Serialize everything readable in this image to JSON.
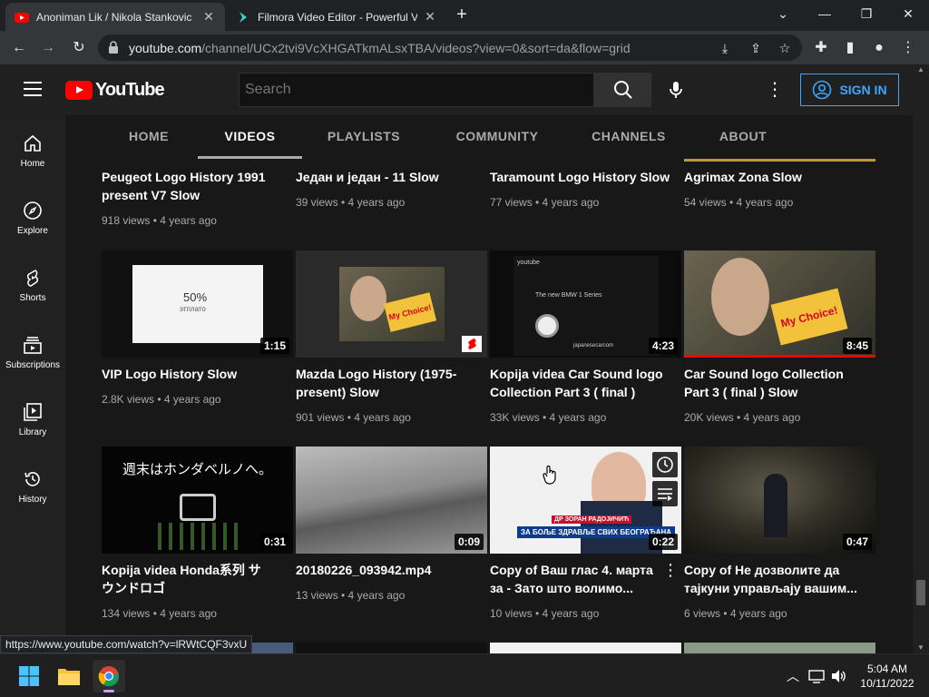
{
  "browser": {
    "tabs": [
      {
        "title": "Anoniman Lik / Nikola Stankovic",
        "active": true
      },
      {
        "title": "Filmora Video Editor - Powerful V",
        "active": false
      }
    ],
    "url_host": "youtube.com",
    "url_path": "/channel/UCx2tvi9VcXHGATkmALsxTBA/videos?view=0&sort=da&flow=grid",
    "status_url": "https://www.youtube.com/watch?v=lRWtCQF3vxU"
  },
  "youtube": {
    "logo_text": "YouTube",
    "search_placeholder": "Search",
    "sign_in": "SIGN IN",
    "guide": [
      {
        "label": "Home",
        "icon": "home-icon"
      },
      {
        "label": "Explore",
        "icon": "compass-icon"
      },
      {
        "label": "Shorts",
        "icon": "shorts-icon"
      },
      {
        "label": "Subscriptions",
        "icon": "subscriptions-icon"
      },
      {
        "label": "Library",
        "icon": "library-icon"
      },
      {
        "label": "History",
        "icon": "history-icon"
      }
    ],
    "channel_tabs": [
      {
        "label": "HOME"
      },
      {
        "label": "VIDEOS"
      },
      {
        "label": "PLAYLISTS"
      },
      {
        "label": "COMMUNITY"
      },
      {
        "label": "CHANNELS"
      },
      {
        "label": "ABOUT"
      }
    ],
    "active_tab": "VIDEOS",
    "row0": [
      {
        "title1": "Peugeot Logo History 1991",
        "title2": "present V7 Slow",
        "meta": "918 views • 4 years ago"
      },
      {
        "title1": "Један и један - 11 Slow",
        "title2": "",
        "meta": "39 views • 4 years ago"
      },
      {
        "title1": "Taramount Logo History Slow",
        "title2": "",
        "meta": "77 views • 4 years ago"
      },
      {
        "title1": "Agrimax Zona Slow",
        "title2": "",
        "meta": "54 views • 4 years ago"
      }
    ],
    "row1": [
      {
        "title1": "VIP Logo History Slow",
        "title2": "",
        "meta": "2.8K views • 4 years ago",
        "duration": "1:15",
        "thumb_text": "50%",
        "thumb_sub": "этплато"
      },
      {
        "title1": "Mazda Logo History (1975-",
        "title2": "present) Slow",
        "meta": "901 views • 4 years ago",
        "duration": "",
        "thumb_text": "My Choice!"
      },
      {
        "title1": "Kopija videa Car Sound logo",
        "title2": "Collection Part 3 ( final )",
        "meta": "33K views • 4 years ago",
        "duration": "4:23",
        "thumb_text": "youtube",
        "thumb_sub": "The new BMW 1 Series",
        "thumb_sub2": "japanesecarcom"
      },
      {
        "title1": "Car Sound logo Collection",
        "title2": "Part 3 ( final ) Slow",
        "meta": "20K views • 4 years ago",
        "duration": "8:45",
        "thumb_text": "My Choice!"
      }
    ],
    "row2": [
      {
        "title1": "Kopija videa Honda系列 サ",
        "title2": "ウンドロゴ",
        "meta": "134 views • 4 years ago",
        "duration": "0:31",
        "thumb_text": "週末はホンダベルノへ。"
      },
      {
        "title1": "20180226_093942.mp4",
        "title2": "",
        "meta": "13 views • 4 years ago",
        "duration": "0:09"
      },
      {
        "title1": "Copy of Ваш глас 4. марта",
        "title2": "за - Зато што волимо...",
        "meta": "10 views • 4 years ago",
        "duration": "0:22",
        "thumb_text": "ЗА БОЉЕ ЗДРАВЉЕ СВИХ БЕОГРАЂАНА",
        "thumb_sub": "ДР ЗОРАН РАДОЈИЧИЋ"
      },
      {
        "title1": "Copy of Не дозволите да",
        "title2": "тајкуни управљају вашим...",
        "meta": "6 views • 4 years ago",
        "duration": "0:47"
      }
    ]
  },
  "taskbar": {
    "time": "5:04 AM",
    "date": "10/11/2022"
  },
  "colors": {
    "accent": "#3ea6ff",
    "brand_red": "#ff0000",
    "bg": "#181818"
  }
}
